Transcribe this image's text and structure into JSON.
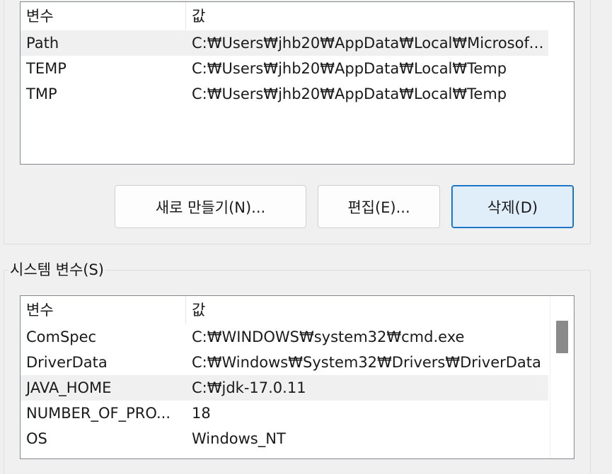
{
  "user_vars": {
    "headers": {
      "name": "변수",
      "value": "값"
    },
    "rows": [
      {
        "name": "Path",
        "value": "C:₩Users₩jhb20₩AppData₩Local₩Microsoft..."
      },
      {
        "name": "TEMP",
        "value": "C:₩Users₩jhb20₩AppData₩Local₩Temp"
      },
      {
        "name": "TMP",
        "value": "C:₩Users₩jhb20₩AppData₩Local₩Temp"
      }
    ]
  },
  "buttons": {
    "new": "새로 만들기(N)...",
    "edit": "편집(E)...",
    "delete": "삭제(D)"
  },
  "system_vars": {
    "group_label": "시스템 변수(S)",
    "headers": {
      "name": "변수",
      "value": "값"
    },
    "rows": [
      {
        "name": "ComSpec",
        "value": "C:₩WINDOWS₩system32₩cmd.exe"
      },
      {
        "name": "DriverData",
        "value": "C:₩Windows₩System32₩Drivers₩DriverData"
      },
      {
        "name": "JAVA_HOME",
        "value": "C:₩jdk-17.0.11"
      },
      {
        "name": "NUMBER_OF_PRO...",
        "value": "18"
      },
      {
        "name": "OS",
        "value": "Windows_NT"
      }
    ]
  }
}
